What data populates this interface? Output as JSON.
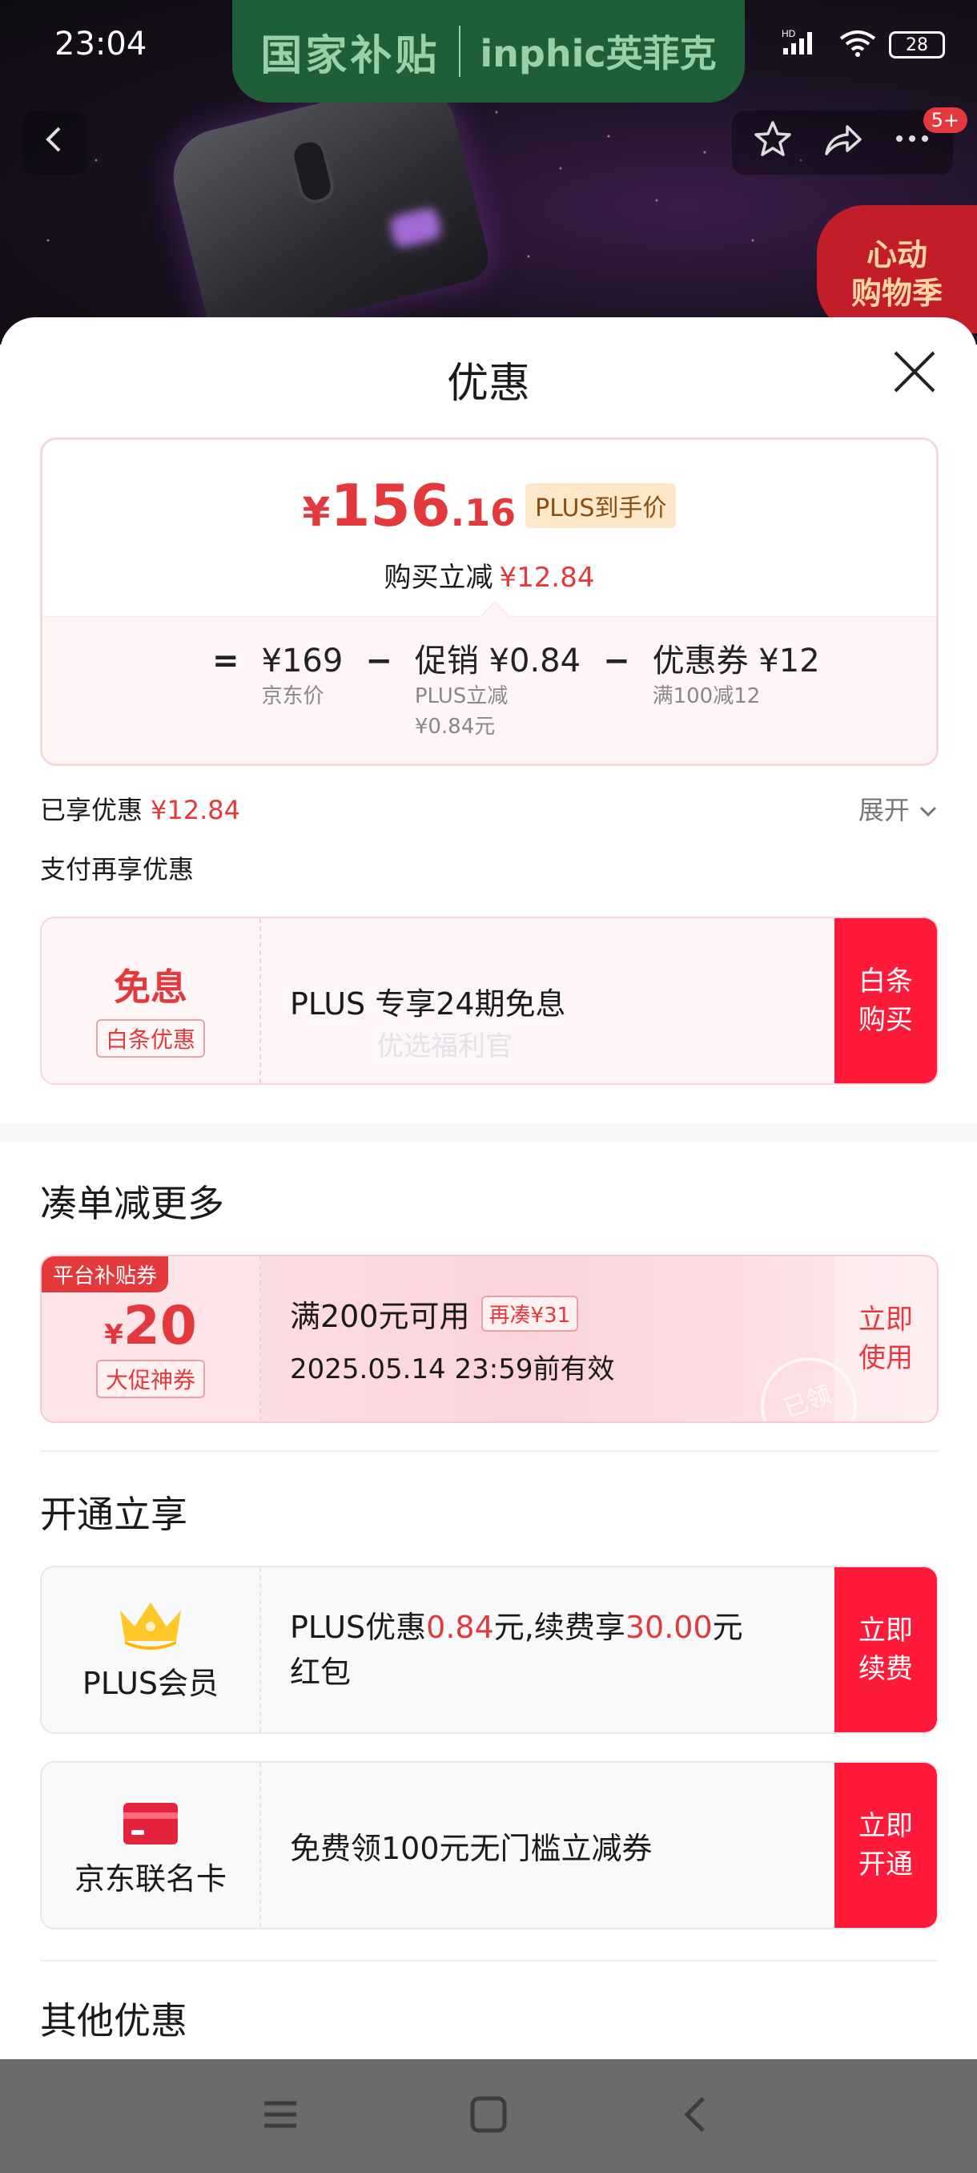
{
  "status_bar": {
    "time": "23:04",
    "network": "HD",
    "battery": "28"
  },
  "banner": {
    "subsidy": "国家补贴",
    "brand": "inphic英菲克"
  },
  "hero": {
    "more_badge": "5+",
    "promo": "心动\n购物季"
  },
  "sheet": {
    "title": "优惠"
  },
  "price_card": {
    "currency": "¥",
    "price_int": "156",
    "price_dec": ".16",
    "plus_tag": "PLUS到手价",
    "instant_label": "购买立减",
    "instant_value": "¥12.84",
    "calc": {
      "eq": "=",
      "jd_price": "¥169",
      "jd_price_label": "京东价",
      "op1": "−",
      "promo_value": "促销 ¥0.84",
      "promo_sub1": "PLUS立减",
      "promo_sub2": "¥0.84元",
      "op2": "−",
      "coupon_value": "优惠券 ¥12",
      "coupon_sub": "满100减12"
    }
  },
  "enjoyed": {
    "label": "已享优惠",
    "value": "¥12.84",
    "expand": "展开"
  },
  "pay_more": "支付再享优惠",
  "baitiao": {
    "big": "免息",
    "tag": "白条优惠",
    "text": "PLUS 专享24期免息",
    "action": "白条\n购买",
    "watermark": "优选福利官"
  },
  "bundle": {
    "title": "凑单减更多",
    "platform_tag": "平台补贴券",
    "currency": "¥",
    "amount": "20",
    "tag": "大促神券",
    "condition": "满200元可用",
    "again": "再凑¥31",
    "valid": "2025.05.14 23:59前有效",
    "action": "立即\n使用",
    "stamp": "已领"
  },
  "activate": {
    "title": "开通立享",
    "plus": {
      "label": "PLUS会员",
      "text_a": "PLUS优惠",
      "val_a": "0.84",
      "text_b": "元,续费享",
      "val_b": "30.00",
      "text_c": "元",
      "text_d": "红包",
      "action": "立即\n续费"
    },
    "card": {
      "label": "京东联名卡",
      "text": "免费领100元无门槛立减券",
      "action": "立即\n开通"
    }
  },
  "other": {
    "title": "其他优惠"
  },
  "colors": {
    "accent": "#e4393c",
    "action_bg": "#ff1a3a"
  },
  "icons": [
    "back-icon",
    "star-icon",
    "share-icon",
    "more-icon",
    "close-icon",
    "chevron-down-icon",
    "crown-icon",
    "credit-card-icon",
    "menu-icon",
    "home-icon",
    "back-nav-icon"
  ]
}
